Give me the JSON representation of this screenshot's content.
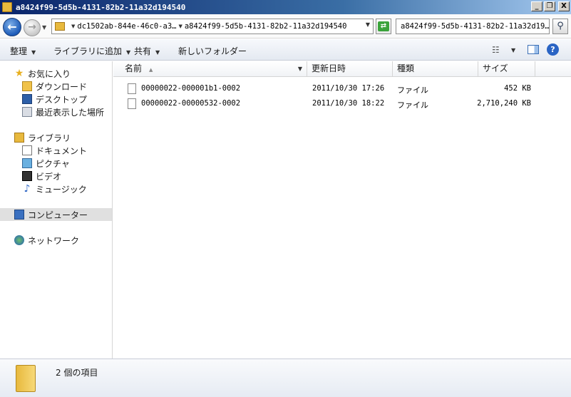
{
  "window": {
    "title": "a8424f99-5d5b-4131-82b2-11a32d194540",
    "controls": {
      "minimize": "_",
      "restore": "❐",
      "close": "X"
    }
  },
  "address": {
    "crumbs": [
      "dc1502ab-844e-46c0-a3…",
      "a8424f99-5d5b-4131-82b2-11a32d194540"
    ]
  },
  "search": {
    "value": "a8424f99-5d5b-4131-82b2-11a32d19…"
  },
  "toolbar": {
    "organize": "整理",
    "add_to_library": "ライブラリに追加",
    "share": "共有",
    "new_folder": "新しいフォルダー"
  },
  "nav": {
    "favorites": "お気に入り",
    "downloads": "ダウンロード",
    "desktop": "デスクトップ",
    "recent": "最近表示した場所",
    "libraries": "ライブラリ",
    "documents": "ドキュメント",
    "pictures": "ピクチャ",
    "videos": "ビデオ",
    "music": "ミュージック",
    "computer": "コンピューター",
    "network": "ネットワーク"
  },
  "columns": {
    "name": "名前",
    "date": "更新日時",
    "type": "種類",
    "size": "サイズ"
  },
  "files": [
    {
      "name": "00000022-000001b1-0002",
      "date": "2011/10/30 17:26",
      "type": "ファイル",
      "size": "452 KB"
    },
    {
      "name": "00000022-00000532-0002",
      "date": "2011/10/30 18:22",
      "type": "ファイル",
      "size": "2,710,240 KB"
    }
  ],
  "status": {
    "count_text": "2 個の項目"
  },
  "icons": {
    "title": "folder-icon",
    "back": "arrow-left-icon",
    "forward": "arrow-right-icon",
    "refresh": "refresh-icon",
    "search": "search-icon",
    "help": "help-icon"
  },
  "colors": {
    "title_start": "#0a246a",
    "accent": "#3a6ea5",
    "selected_nav": "#e0e0e0"
  }
}
